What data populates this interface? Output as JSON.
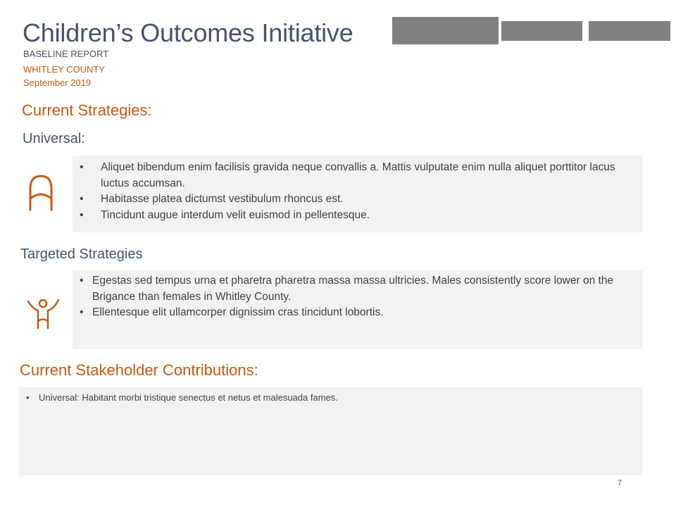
{
  "header": {
    "title": "Children’s Outcomes Initiative",
    "subtitle": "BASELINE REPORT",
    "county": "WHITLEY COUNTY",
    "date": "September  2019"
  },
  "colors": {
    "accent": "#c55a11",
    "heading": "#44546a",
    "panel": "#f2f2f2",
    "header_blocks": "#808080"
  },
  "sections": {
    "current_strategies": {
      "heading": "Current Strategies:",
      "universal": {
        "heading": "Universal:",
        "icon": "arch-icon",
        "bullets": [
          "Aliquet bibendum enim facilisis gravida neque convallis a. Mattis vulputate enim nulla aliquet porttitor lacus luctus accumsan.",
          "Habitasse platea dictumst vestibulum rhoncus est.",
          "Tincidunt augue interdum velit euismod in pellentesque."
        ]
      },
      "targeted": {
        "heading": "Targeted Strategies",
        "icon": "child-arms-up-icon",
        "bullets": [
          "Egestas sed tempus urna et pharetra pharetra massa massa ultricies. Males consistently score lower on the Brigance than females in Whitley County.",
          "Ellentesque elit ullamcorper dignissim cras tincidunt lobortis."
        ]
      }
    },
    "stakeholders": {
      "heading": "Current Stakeholder Contributions:",
      "bullets": [
        "Universal:  Habitant morbi tristique senectus et netus et malesuada fames."
      ]
    }
  },
  "page_number": "7"
}
